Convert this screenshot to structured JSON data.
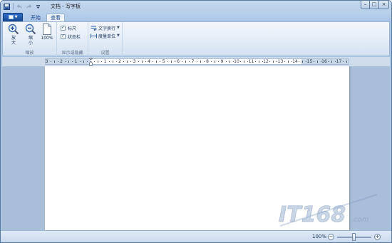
{
  "window": {
    "title": "文档 - 写字板",
    "caption": {
      "minimize": "–",
      "maximize": "□",
      "close": "×"
    }
  },
  "quick_access": {
    "icons": [
      "save-icon",
      "undo-icon",
      "redo-icon",
      "customize-dropdown-icon"
    ]
  },
  "tabs": [
    {
      "label": "开始",
      "selected": false
    },
    {
      "label": "查看",
      "selected": true
    }
  ],
  "ribbon": {
    "zoom_group": {
      "label": "缩放",
      "zoom_in": "放大",
      "zoom_out": "缩小",
      "actual_size": "100%"
    },
    "show_group": {
      "label": "显示或隐藏",
      "ruler": {
        "label": "标尺",
        "checked": true
      },
      "statusbar": {
        "label": "状态栏",
        "checked": true
      }
    },
    "settings_group": {
      "label": "设置",
      "word_wrap": "文字换行",
      "measurement_units": "度量单位"
    }
  },
  "ruler": {
    "labels": [
      "3",
      "2",
      "1",
      "1",
      "2",
      "3",
      "4",
      "5",
      "6",
      "7",
      "8",
      "9",
      "10",
      "11",
      "12",
      "13",
      "14",
      "15",
      "16",
      "17"
    ]
  },
  "statusbar": {
    "zoom_percent": "100%",
    "zoom_level": 0.5,
    "minus": "−",
    "plus": "+"
  },
  "watermark": {
    "brand": "IT168",
    "suffix": ".com"
  },
  "colors": {
    "accent": "#1a4c9a",
    "frame": "#b9d0ea",
    "workspace": "#a9bed9"
  }
}
